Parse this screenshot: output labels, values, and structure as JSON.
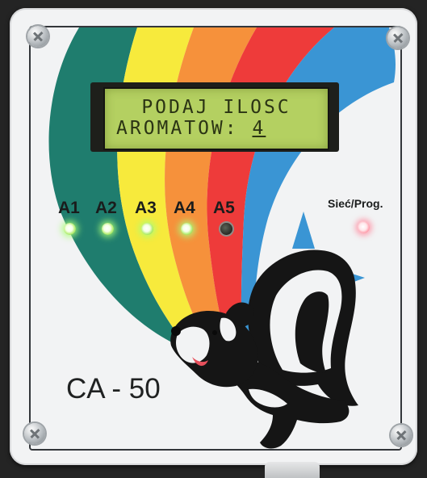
{
  "lcd": {
    "line1": "PODAJ ILOSC",
    "line2_label": "AROMATOW:",
    "line2_value": "4"
  },
  "channels": [
    {
      "label": "A1",
      "led": "on"
    },
    {
      "label": "A2",
      "led": "on"
    },
    {
      "label": "A3",
      "led": "on"
    },
    {
      "label": "A4",
      "led": "on"
    },
    {
      "label": "A5",
      "led": "off"
    }
  ],
  "status": {
    "label": "Sieć/Prog.",
    "led": "on"
  },
  "model": "CA - 50",
  "colors": {
    "band_teal": "#1f7d6e",
    "band_yellow": "#f7ea3c",
    "band_orange": "#f6913b",
    "band_red": "#ee3b3a",
    "band_blue": "#3a95d4",
    "lcd_background": "#b4d061",
    "lcd_text": "#2b3414"
  },
  "icons": [
    "screw-icon",
    "skunk-mascot-icon",
    "arrow-up-icon",
    "arrow-right-icon",
    "arrow-down-icon"
  ]
}
